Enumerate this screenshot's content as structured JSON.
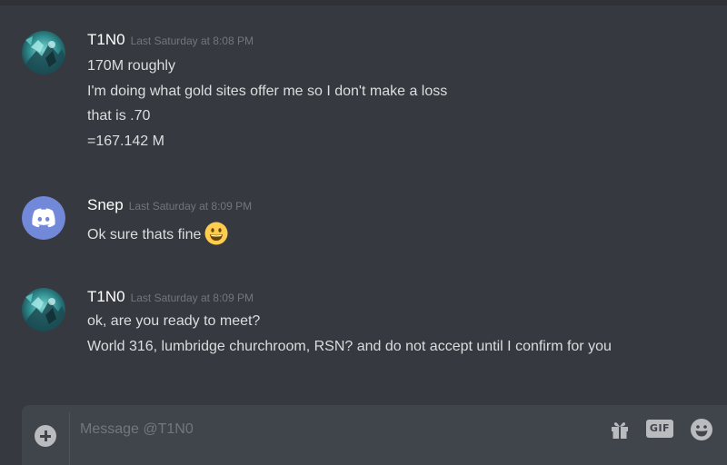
{
  "messages": [
    {
      "author": "T1N0",
      "avatar": "custom-avatar",
      "timestamp": "Last Saturday at 8:08 PM",
      "lines": [
        "170M roughly",
        "I'm doing what gold sites offer me so I don't make a loss",
        "that is .70",
        "=167.142 M"
      ]
    },
    {
      "author": "Snep",
      "avatar": "discord-default-avatar",
      "avatar_color": "#7289da",
      "timestamp": "Last Saturday at 8:09 PM",
      "lines": [
        "Ok sure thats fine"
      ],
      "emoji": "smiley"
    },
    {
      "author": "T1N0",
      "avatar": "custom-avatar",
      "timestamp": "Last Saturday at 8:09 PM",
      "lines": [
        "ok, are you ready to meet?",
        "World 316, lumbridge churchroom, RSN? and do not accept until I confirm for you"
      ]
    }
  ],
  "composer": {
    "placeholder": "Message @T1N0",
    "value": "",
    "gif_label": "GIF",
    "tools": [
      "plus-icon",
      "gift-icon",
      "gif-icon",
      "emoji-icon"
    ]
  },
  "colors": {
    "background": "#36393f",
    "composer": "#40444b",
    "username": "#ffffff",
    "text": "#dcddde",
    "timestamp": "#72767d",
    "blurple": "#7289da"
  }
}
